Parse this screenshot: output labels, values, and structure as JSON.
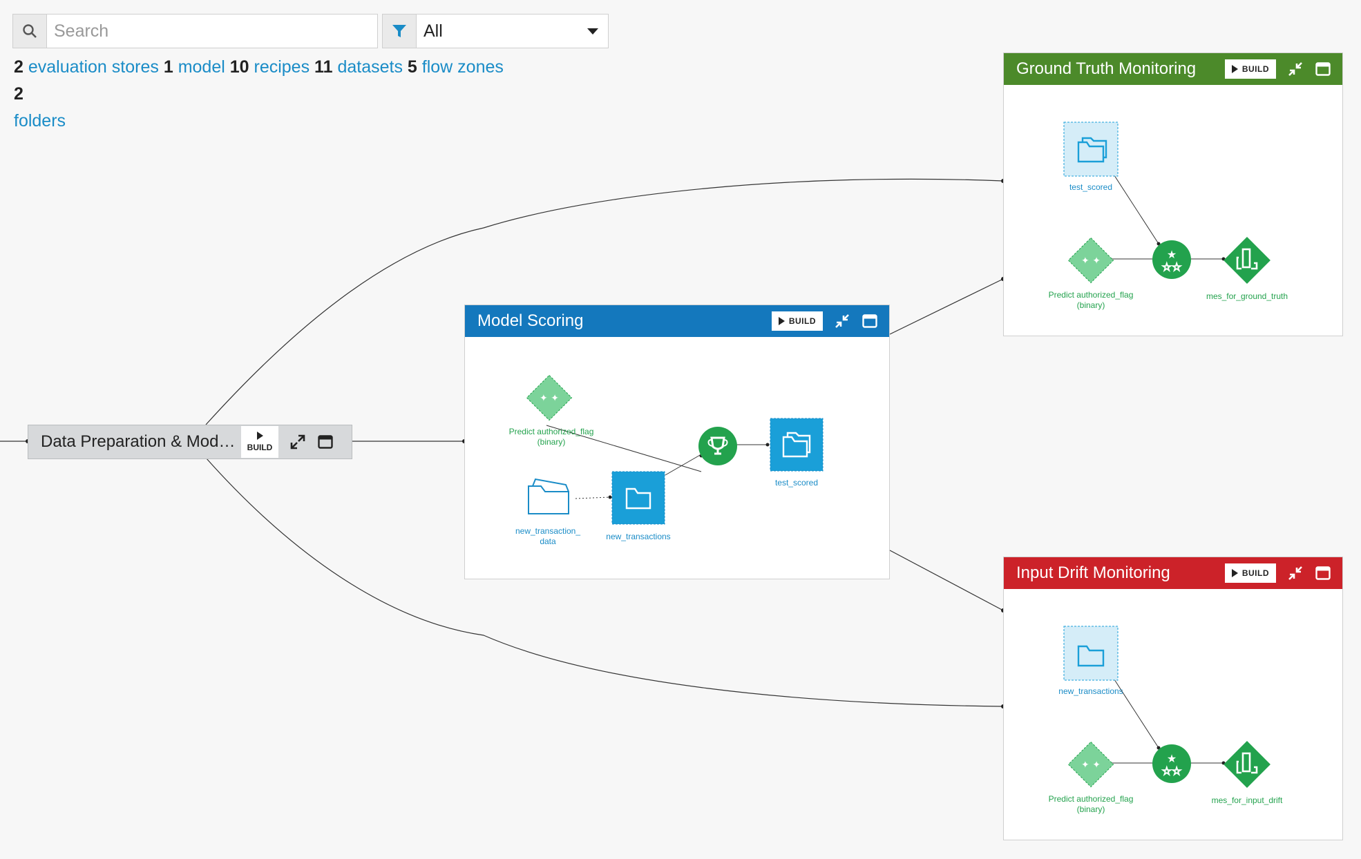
{
  "search": {
    "placeholder": "Search"
  },
  "filter": {
    "value": "All"
  },
  "summary": {
    "evaluation_stores_count": "2",
    "evaluation_stores_label": "evaluation stores",
    "model_count": "1",
    "model_label": "model",
    "recipes_count": "10",
    "recipes_label": "recipes",
    "datasets_count": "11",
    "datasets_label": "datasets",
    "flow_zones_count": "5",
    "flow_zones_label": "flow zones",
    "folders_count": "2",
    "folders_label": "folders"
  },
  "zones": {
    "data_prep": {
      "title": "Data Preparation & Model Training",
      "build_label": "BUILD",
      "color": "#d7d9db"
    },
    "model_scoring": {
      "title": "Model Scoring",
      "build_label": "BUILD",
      "color": "#1478bd"
    },
    "ground_truth": {
      "title": "Ground Truth Monitoring",
      "build_label": "BUILD",
      "color": "#4c8a2a"
    },
    "input_drift": {
      "title": "Input Drift Monitoring",
      "build_label": "BUILD",
      "color": "#cc2229"
    }
  },
  "nodes": {
    "ms_model_label": "Predict authorized_flag (binary)",
    "ms_folder_label": "new_transaction_ data",
    "ms_newtx_label": "new_transactions",
    "ms_testscored_label": "test_scored",
    "gt_testscored_label": "test_scored",
    "gt_model_label": "Predict authorized_flag (binary)",
    "gt_mes_label": "mes_for_ground_truth",
    "id_newtx_label": "new_transactions",
    "id_model_label": "Predict authorized_flag (binary)",
    "id_mes_label": "mes_for_input_drift"
  },
  "icons": [
    "search-icon",
    "filter-icon",
    "chevron-down-icon",
    "play-icon",
    "collapse-icon",
    "window-icon",
    "expand-icon",
    "folder-icon",
    "trophy-icon",
    "stars-icon",
    "model-icon",
    "evaluation-store-icon"
  ]
}
